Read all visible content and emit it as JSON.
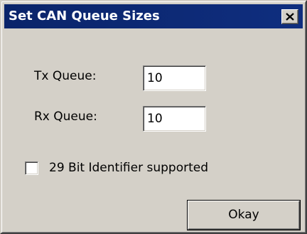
{
  "window": {
    "title": "Set CAN Queue Sizes"
  },
  "icons": {
    "close": "close-icon"
  },
  "colors": {
    "titlebar": "#0a246a",
    "dialog_bg": "#d4d0c8"
  },
  "form": {
    "tx_label": "Tx Queue:",
    "tx_value": "10",
    "rx_label": "Rx Queue:",
    "rx_value": "10",
    "checkbox_label": "29 Bit Identifier supported",
    "checkbox_checked": false
  },
  "buttons": {
    "okay_label": "Okay"
  }
}
